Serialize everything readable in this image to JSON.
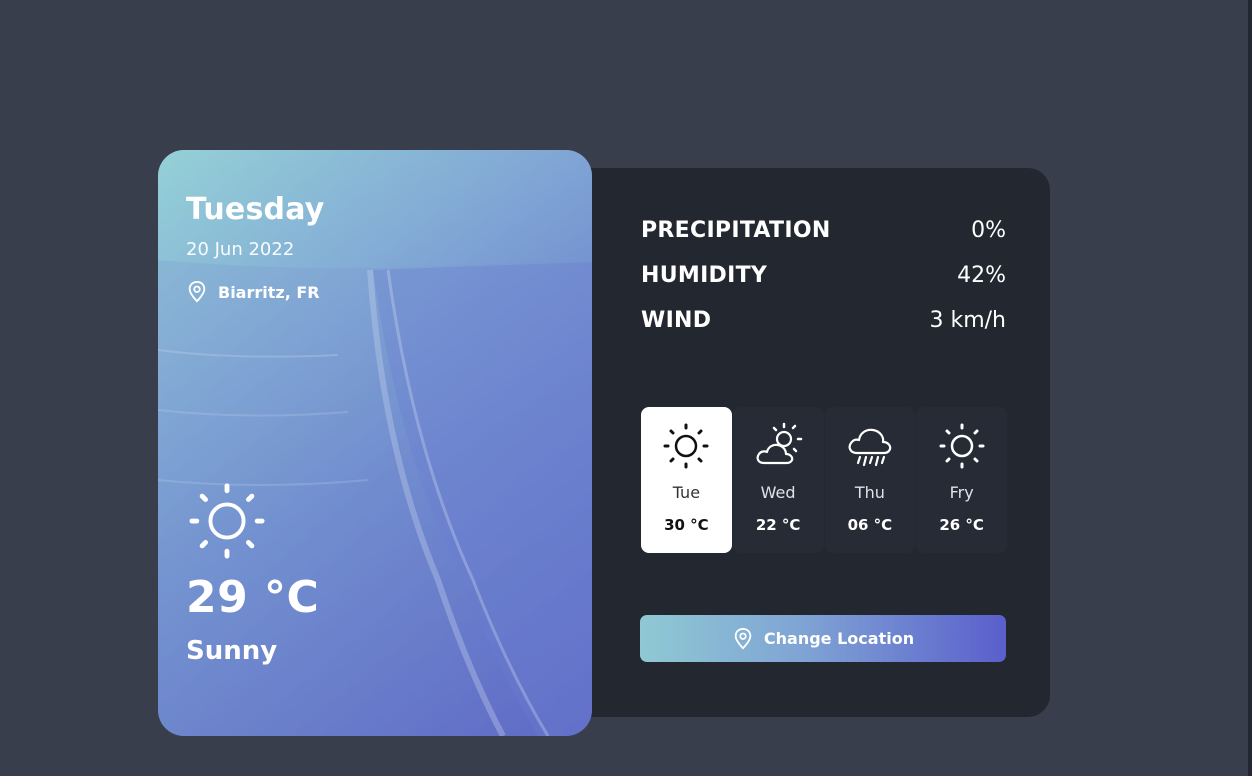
{
  "hero": {
    "day": "Tuesday",
    "date": "20 Jun 2022",
    "location": "Biarritz, FR",
    "location_icon": "map-pin-icon",
    "weather_icon": "sun-icon",
    "temperature": "29 °C",
    "condition": "Sunny"
  },
  "stats": [
    {
      "label": "PRECIPITATION",
      "value": "0%"
    },
    {
      "label": "HUMIDITY",
      "value": "42%"
    },
    {
      "label": "WIND",
      "value": "3 km/h"
    }
  ],
  "forecast": [
    {
      "day": "Tue",
      "temp": "30 °C",
      "icon": "sun-icon",
      "selected": true
    },
    {
      "day": "Wed",
      "temp": "22 °C",
      "icon": "partly-cloudy-icon",
      "selected": false
    },
    {
      "day": "Thu",
      "temp": "06 °C",
      "icon": "rain-cloud-icon",
      "selected": false
    },
    {
      "day": "Fry",
      "temp": "26 °C",
      "icon": "sun-icon",
      "selected": false
    }
  ],
  "button": {
    "label": "Change Location",
    "icon": "map-pin-icon"
  },
  "colors": {
    "background": "#383e4b",
    "panel": "#232730",
    "accent_start": "#8fc9d3",
    "accent_end": "#5a5fcc"
  }
}
